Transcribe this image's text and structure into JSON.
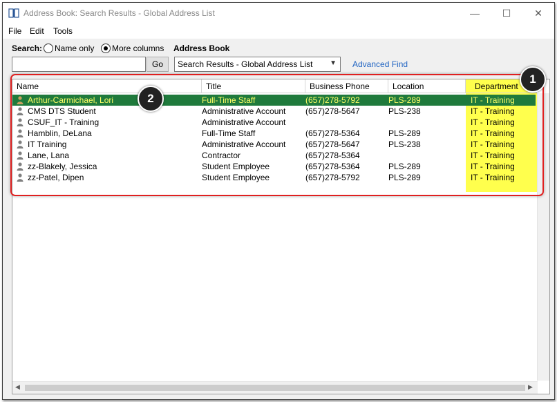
{
  "window": {
    "title": "Address Book: Search Results - Global Address List",
    "controls": {
      "minimize": "—",
      "maximize": "☐",
      "close": "✕"
    }
  },
  "menu": [
    "File",
    "Edit",
    "Tools"
  ],
  "search": {
    "label": "Search:",
    "options": [
      "Name only",
      "More columns"
    ],
    "selected_option": "More columns",
    "query": "",
    "go_label": "Go"
  },
  "address_book": {
    "label": "Address Book",
    "selected": "Search Results - Global Address List",
    "advanced_find": "Advanced Find"
  },
  "table": {
    "columns": [
      "Name",
      "Title",
      "Business Phone",
      "Location",
      "Department"
    ],
    "rows": [
      {
        "name": "Arthur-Carmichael, Lori",
        "title": "Full-Time Staff",
        "phone": "(657)278-5792",
        "location": "PLS-289",
        "department": "IT - Training",
        "selected": true
      },
      {
        "name": "CMS DTS Student",
        "title": "Administrative Account",
        "phone": "(657)278-5647",
        "location": "PLS-238",
        "department": "IT - Training"
      },
      {
        "name": "CSUF_IT - Training",
        "title": "Administrative Account",
        "phone": "",
        "location": "",
        "department": "IT - Training"
      },
      {
        "name": "Hamblin, DeLana",
        "title": "Full-Time Staff",
        "phone": "(657)278-5364",
        "location": "PLS-289",
        "department": "IT - Training"
      },
      {
        "name": "IT Training",
        "title": "Administrative Account",
        "phone": "(657)278-5647",
        "location": "PLS-238",
        "department": "IT - Training"
      },
      {
        "name": "Lane, Lana",
        "title": "Contractor",
        "phone": "(657)278-5364",
        "location": "",
        "department": "IT - Training"
      },
      {
        "name": "zz-Blakely, Jessica",
        "title": "Student Employee",
        "phone": "(657)278-5364",
        "location": "PLS-289",
        "department": "IT - Training"
      },
      {
        "name": "zz-Patel, Dipen",
        "title": "Student Employee",
        "phone": "(657)278-5792",
        "location": "PLS-289",
        "department": "IT - Training"
      }
    ]
  },
  "callouts": [
    "1",
    "2"
  ],
  "colors": {
    "selected_row": "#1f7a3c",
    "highlight": "#ffff4d",
    "annotation": "#e02020",
    "link": "#1f63c2"
  }
}
